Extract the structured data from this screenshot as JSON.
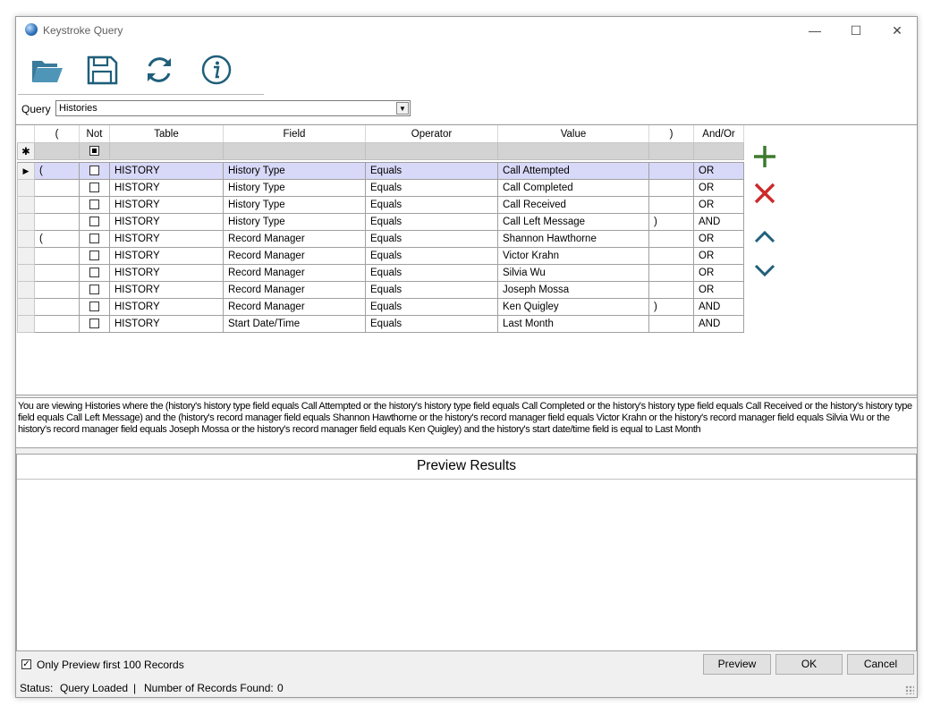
{
  "window": {
    "title": "Keystroke Query",
    "controls": {
      "minimize": "—",
      "maximize": "☐",
      "close": "✕"
    }
  },
  "toolbar": {
    "buttons": [
      {
        "name": "open",
        "icon": "folder-open-icon"
      },
      {
        "name": "save",
        "icon": "floppy-disk-icon"
      },
      {
        "name": "refresh",
        "icon": "refresh-icon"
      },
      {
        "name": "info",
        "icon": "info-icon"
      }
    ]
  },
  "query": {
    "label": "Query",
    "value": "Histories"
  },
  "grid": {
    "columns": [
      "(",
      "Not",
      "Table",
      "Field",
      "Operator",
      "Value",
      ")",
      "And/Or"
    ],
    "new_row_marker": "✱",
    "selected_row_marker": "▶",
    "rows": [
      {
        "open_paren": "(",
        "not": false,
        "table": "HISTORY",
        "field": "History Type",
        "operator": "Equals",
        "value": "Call Attempted",
        "close_paren": "",
        "andor": "OR"
      },
      {
        "open_paren": "",
        "not": false,
        "table": "HISTORY",
        "field": "History Type",
        "operator": "Equals",
        "value": "Call Completed",
        "close_paren": "",
        "andor": "OR"
      },
      {
        "open_paren": "",
        "not": false,
        "table": "HISTORY",
        "field": "History Type",
        "operator": "Equals",
        "value": "Call Received",
        "close_paren": "",
        "andor": "OR"
      },
      {
        "open_paren": "",
        "not": false,
        "table": "HISTORY",
        "field": "History Type",
        "operator": "Equals",
        "value": "Call Left Message",
        "close_paren": ")",
        "andor": "AND"
      },
      {
        "open_paren": "(",
        "not": false,
        "table": "HISTORY",
        "field": "Record Manager",
        "operator": "Equals",
        "value": "Shannon Hawthorne",
        "close_paren": "",
        "andor": "OR"
      },
      {
        "open_paren": "",
        "not": false,
        "table": "HISTORY",
        "field": "Record Manager",
        "operator": "Equals",
        "value": "Victor Krahn",
        "close_paren": "",
        "andor": "OR"
      },
      {
        "open_paren": "",
        "not": false,
        "table": "HISTORY",
        "field": "Record Manager",
        "operator": "Equals",
        "value": "Silvia Wu",
        "close_paren": "",
        "andor": "OR"
      },
      {
        "open_paren": "",
        "not": false,
        "table": "HISTORY",
        "field": "Record Manager",
        "operator": "Equals",
        "value": "Joseph Mossa",
        "close_paren": "",
        "andor": "OR"
      },
      {
        "open_paren": "",
        "not": false,
        "table": "HISTORY",
        "field": "Record Manager",
        "operator": "Equals",
        "value": "Ken Quigley",
        "close_paren": ")",
        "andor": "AND"
      },
      {
        "open_paren": "",
        "not": false,
        "table": "HISTORY",
        "field": "Start Date/Time",
        "operator": "Equals",
        "value": "Last Month",
        "close_paren": "",
        "andor": "AND"
      }
    ]
  },
  "side_buttons": [
    {
      "name": "add",
      "icon": "plus-icon",
      "color": "#3d7a2e"
    },
    {
      "name": "delete",
      "icon": "x-icon",
      "color": "#cc2a2a"
    },
    {
      "name": "move-up",
      "icon": "chevron-up-icon",
      "color": "#1f5f7a"
    },
    {
      "name": "move-down",
      "icon": "chevron-down-icon",
      "color": "#1f5f7a"
    }
  ],
  "description": "You are viewing Histories where the (history's history type field equals Call Attempted or the history's history type field equals Call Completed or the history's history type field equals Call Received or the history's history type field equals Call Left Message) and the (history's record manager field equals Shannon Hawthorne or the history's record manager field equals Victor Krahn or the history's record manager field equals Silvia Wu or the history's record manager field equals Joseph Mossa or the history's record manager field equals Ken Quigley) and the history's start date/time field is equal to Last Month",
  "preview": {
    "title": "Preview Results"
  },
  "options": {
    "only_preview_label": "Only Preview first 100 Records",
    "only_preview_checked": true
  },
  "buttons": {
    "preview": "Preview",
    "ok": "OK",
    "cancel": "Cancel"
  },
  "status": {
    "label": "Status:",
    "state": "Query Loaded",
    "separator": "|",
    "records_label": "Number of Records Found:",
    "records_count": "0"
  },
  "colors": {
    "icon_teal": "#1f5f7a",
    "selected_row": "#d8d8f8",
    "new_row": "#d3d3d3"
  }
}
